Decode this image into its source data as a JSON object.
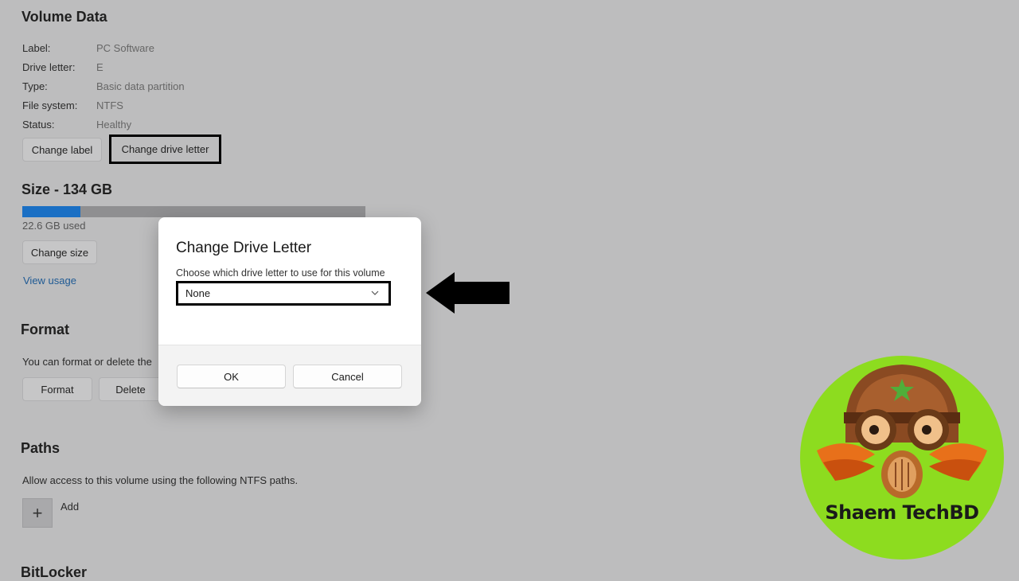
{
  "volume_data": {
    "heading": "Volume Data",
    "properties": [
      {
        "label": "Label:",
        "value": "PC Software"
      },
      {
        "label": "Drive letter:",
        "value": "E"
      },
      {
        "label": "Type:",
        "value": "Basic data partition"
      },
      {
        "label": "File system:",
        "value": "NTFS"
      },
      {
        "label": "Status:",
        "value": "Healthy"
      }
    ],
    "change_label_button": "Change label",
    "change_drive_letter_button": "Change drive letter"
  },
  "size": {
    "heading": "Size - 134 GB",
    "used_text": "22.6 GB used",
    "used_fraction": 0.169,
    "change_size_button": "Change size",
    "view_usage_link": "View usage"
  },
  "format": {
    "heading": "Format",
    "description": "You can format or delete the",
    "format_button": "Format",
    "delete_button": "Delete"
  },
  "paths": {
    "heading": "Paths",
    "description": "Allow access to this volume using the following NTFS paths.",
    "add_label": "Add"
  },
  "bitlocker": {
    "heading": "BitLocker"
  },
  "dialog": {
    "title": "Change Drive Letter",
    "prompt": "Choose which drive letter to use for this volume",
    "selected_value": "None",
    "ok_button": "OK",
    "cancel_button": "Cancel"
  },
  "watermark": {
    "text": "Shaem TechBD"
  },
  "colors": {
    "accent": "#1a6fc4",
    "backdrop": "#bdbdbe",
    "logo_green": "#8ddc1f"
  }
}
